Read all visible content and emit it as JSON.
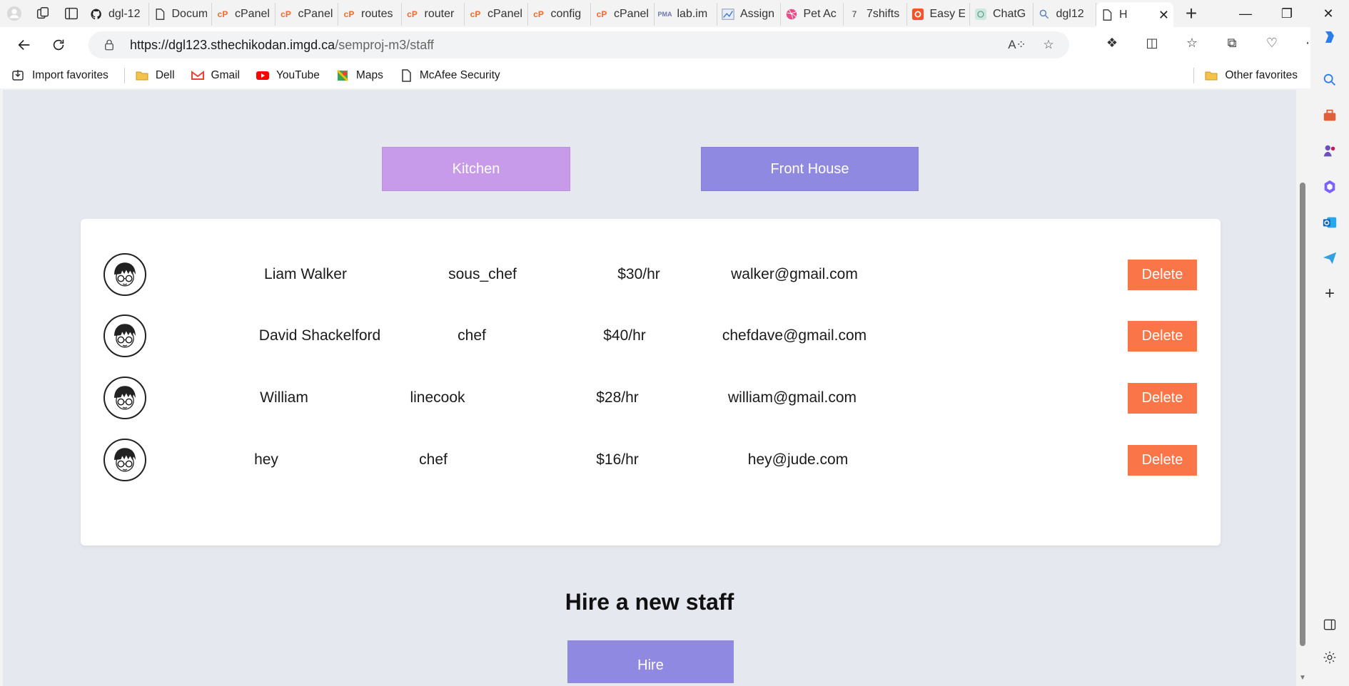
{
  "browser": {
    "tabs": [
      {
        "title": "dgl-12",
        "icon": "github-icon"
      },
      {
        "title": "Docum",
        "icon": "document-icon"
      },
      {
        "title": "cPanel",
        "icon": "cpanel-icon"
      },
      {
        "title": "cPanel",
        "icon": "cpanel-icon"
      },
      {
        "title": "routes",
        "icon": "cpanel-icon"
      },
      {
        "title": "router",
        "icon": "cpanel-icon"
      },
      {
        "title": "cPanel",
        "icon": "cpanel-icon"
      },
      {
        "title": "config",
        "icon": "cpanel-icon"
      },
      {
        "title": "cPanel",
        "icon": "cpanel-icon"
      },
      {
        "title": "lab.im",
        "icon": "phpmyadmin-icon"
      },
      {
        "title": "Assign",
        "icon": "chart-icon"
      },
      {
        "title": "Pet Ac",
        "icon": "dribbble-icon"
      },
      {
        "title": "7shifts",
        "icon": "7shifts-icon"
      },
      {
        "title": "Easy E",
        "icon": "easy-icon"
      },
      {
        "title": "ChatG",
        "icon": "chatgpt-icon"
      },
      {
        "title": "dgl12",
        "icon": "search-icon"
      },
      {
        "title": "H",
        "icon": "document-icon",
        "active": true
      }
    ],
    "url_host": "https://dgl123.sthechikodan.imgd.ca",
    "url_path": "/semproj-m3/staff",
    "bookmarks": [
      {
        "label": "Import favorites",
        "icon": "import-icon"
      },
      {
        "label": "Dell",
        "icon": "folder-icon"
      },
      {
        "label": "Gmail",
        "icon": "gmail-icon"
      },
      {
        "label": "YouTube",
        "icon": "youtube-icon"
      },
      {
        "label": "Maps",
        "icon": "maps-icon"
      },
      {
        "label": "McAfee Security",
        "icon": "document-icon"
      }
    ],
    "other_favorites": "Other favorites"
  },
  "page": {
    "kitchen_label": "Kitchen",
    "front_house_label": "Front House",
    "staff": [
      {
        "name": "Liam Walker",
        "role": "sous_chef",
        "rate": "$30/hr",
        "email": "walker@gmail.com",
        "delete": "Delete"
      },
      {
        "name": "David Shackelford",
        "role": "chef",
        "rate": "$40/hr",
        "email": "chefdave@gmail.com",
        "delete": "Delete"
      },
      {
        "name": "William",
        "role": "linecook",
        "rate": "$28/hr",
        "email": "william@gmail.com",
        "delete": "Delete"
      },
      {
        "name": "hey",
        "role": "chef",
        "rate": "$16/hr",
        "email": "hey@jude.com",
        "delete": "Delete"
      }
    ],
    "hire_title": "Hire a new staff",
    "hire_label": "Hire"
  },
  "colors": {
    "kitchen": "#c89aea",
    "front_house": "#9089e2",
    "delete": "#fa7547",
    "page_bg": "#e6e8ef"
  }
}
